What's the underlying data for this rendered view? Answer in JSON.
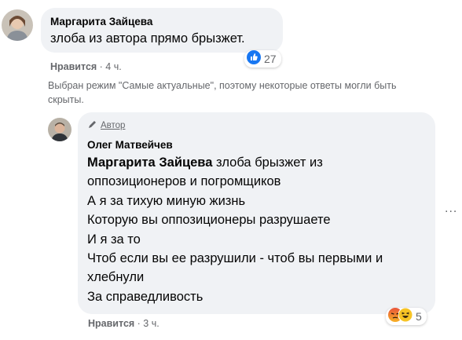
{
  "comment1": {
    "author": "Маргарита Зайцева",
    "text": "злоба из автора прямо брызжет.",
    "like_label": "Нравится",
    "time": "· 4 ч.",
    "reaction_count": "27",
    "reaction_icon": "thumbs-up-icon"
  },
  "notice": {
    "line1": "Выбран режим \"Самые актуальные\", поэтому некоторые ответы могли быть",
    "line2": "скрыты."
  },
  "reply": {
    "badge": "Автор",
    "author": "Олег Матвейчев",
    "mention": "Маргарита Зайцева",
    "lines": [
      " злоба брызжет из",
      "оппозиционеров и погромщиков",
      "А я за тихую миную жизнь",
      "Которую вы оппозиционеры разрушаете",
      "И я за то",
      "Чтоб если вы ее разрушили - чтоб вы первыми и",
      "хлебнули",
      "За справедливость"
    ],
    "like_label": "Нравится",
    "time": "· 3 ч.",
    "reaction_count": "5",
    "reaction_icons": [
      "angry-icon",
      "haha-icon"
    ],
    "more_options": "..."
  },
  "colors": {
    "bubble_bg": "#f0f2f5",
    "meta_text": "#65676b",
    "like_blue": "#1877f2"
  }
}
